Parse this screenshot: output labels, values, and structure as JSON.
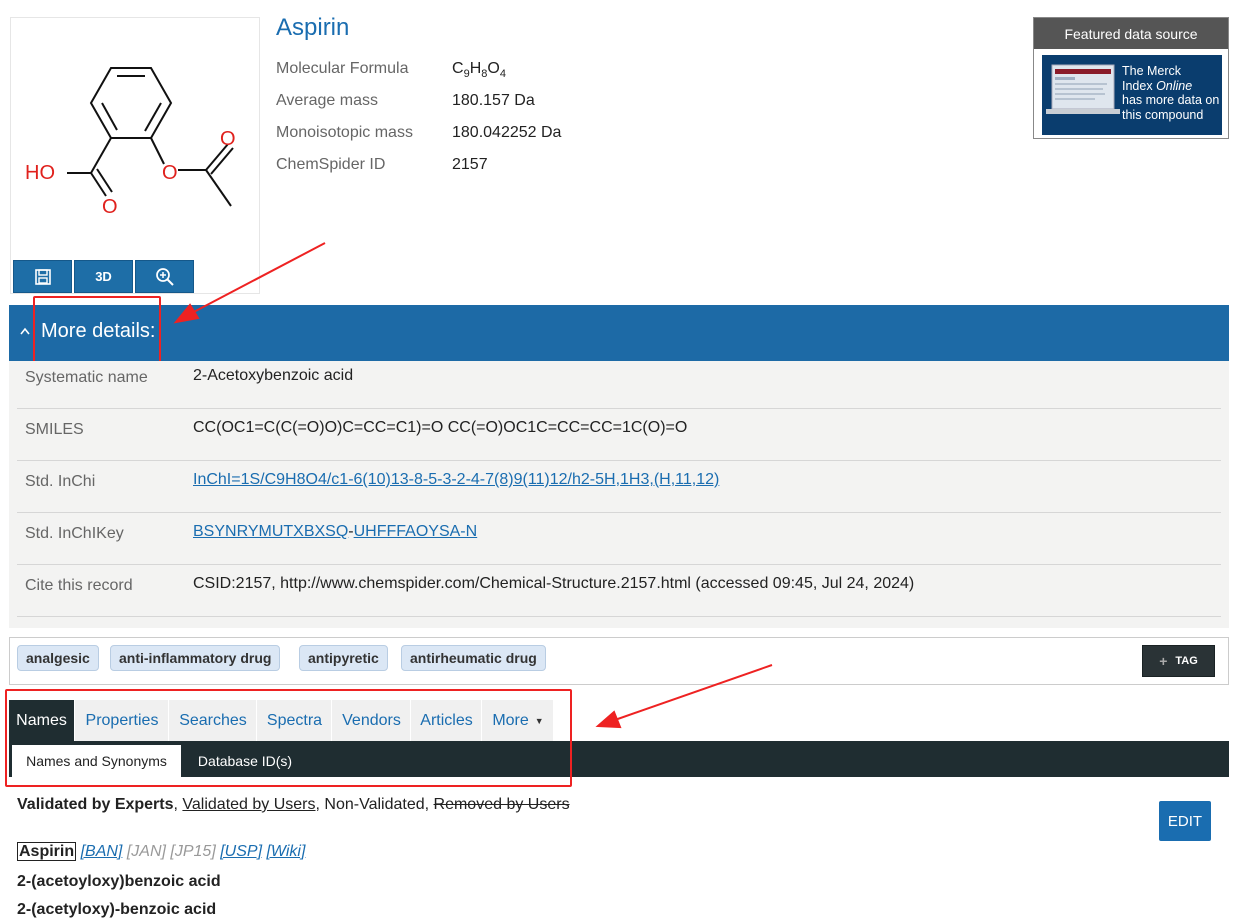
{
  "compound": {
    "name": "Aspirin",
    "properties": [
      {
        "label": "Molecular Formula",
        "value": "C9H8O4"
      },
      {
        "label": "Average mass",
        "value": "180.157 Da"
      },
      {
        "label": "Monoisotopic mass",
        "value": "180.042252 Da"
      },
      {
        "label": "ChemSpider ID",
        "value": "2157"
      }
    ]
  },
  "structure": {
    "atoms": {
      "ho": "HO",
      "o_carbonyl": "O",
      "o_ester": "O",
      "o_acetyl": "O"
    },
    "tools": {
      "three_d": "3D"
    }
  },
  "featured": {
    "header": "Featured data source",
    "line1": "The Merck",
    "line2_prefix": "Index ",
    "line2_italic": "Online",
    "line3": "has more data on",
    "line4": "this compound"
  },
  "details": {
    "title": "More details:",
    "rows": [
      {
        "label": "Systematic name",
        "value": "2-Acetoxybenzoic acid"
      },
      {
        "label": "SMILES",
        "value": "CC(OC1=C(C(=O)O)C=CC=C1)=O CC(=O)OC1C=CC=CC=1C(O)=O"
      },
      {
        "label": "Std. InChi",
        "value": "InChI=1S/C9H8O4/c1-6(10)13-8-5-3-2-4-7(8)9(11)12/h2-5H,1H3,(H,11,12)"
      },
      {
        "label": "Std. InChIKey",
        "value_part1": "BSYNRYMUTXBXSQ",
        "value_sep": "-",
        "value_part2": "UHFFFAOYSA-N"
      },
      {
        "label": "Cite this record",
        "value": "CSID:2157, http://www.chemspider.com/Chemical-Structure.2157.html (accessed 09:45, Jul 24, 2024)"
      }
    ]
  },
  "tags": [
    "analgesic",
    "anti-inflammatory drug",
    "antipyretic",
    "antirheumatic drug"
  ],
  "tag_button": "TAG",
  "tabs": [
    "Names",
    "Properties",
    "Searches",
    "Spectra",
    "Vendors",
    "Articles",
    "More"
  ],
  "subtabs": [
    "Names and Synonyms",
    "Database ID(s)"
  ],
  "validation": {
    "experts": "Validated by Experts",
    "users": "Validated by Users",
    "non": "Non-Validated",
    "removed": "Removed by Users"
  },
  "edit_label": "EDIT",
  "names": {
    "primary": "Aspirin",
    "sources": [
      "[BAN]",
      "[JAN]",
      "[JP15]",
      "[USP]",
      "[Wiki]"
    ],
    "list": [
      "2-(acetoyloxy)benzoic acid",
      "2-(acetyloxy)-benzoic acid"
    ]
  }
}
